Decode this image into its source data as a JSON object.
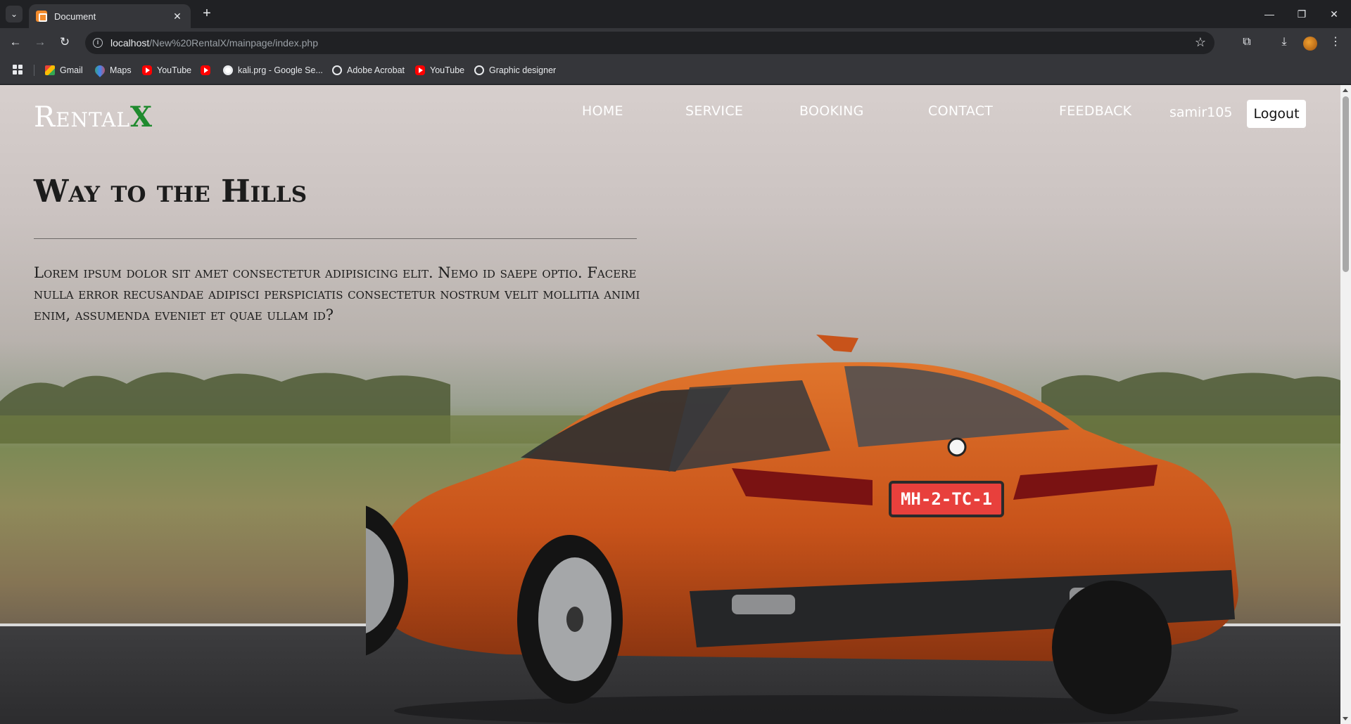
{
  "browser": {
    "tab_title": "Document",
    "url_host": "localhost",
    "url_path": "/New%20RentalX/mainpage/index.php",
    "bookmarks": [
      {
        "label": "Gmail",
        "icon": "gmail-icon"
      },
      {
        "label": "Maps",
        "icon": "maps-icon"
      },
      {
        "label": "YouTube",
        "icon": "youtube-icon"
      },
      {
        "label": "",
        "icon": "youtube-icon"
      },
      {
        "label": "kali.prg - Google Se...",
        "icon": "google-icon"
      },
      {
        "label": "Adobe Acrobat",
        "icon": "globe-icon"
      },
      {
        "label": "YouTube",
        "icon": "youtube-icon"
      },
      {
        "label": "Graphic designer",
        "icon": "globe-icon"
      }
    ]
  },
  "site": {
    "logo_main": "Rental",
    "logo_accent": "X",
    "accent_color": "#1f8a2e",
    "nav": [
      "HOME",
      "SERVICE",
      "BOOKING",
      "CONTACT",
      "FEEDBACK"
    ],
    "username": "samir105",
    "logout_label": "Logout"
  },
  "hero": {
    "title": "Way to the Hills",
    "text": "Lorem ipsum dolor sit amet consectetur adipisicing elit. Nemo id saepe optio. Facere nulla error recusandae adipisci perspiciatis consectetur nostrum velit mollitia animi enim, assumenda eveniet et quae ullam id?",
    "plate": "MH-2-TC-1",
    "car_color": "#c8531a"
  }
}
